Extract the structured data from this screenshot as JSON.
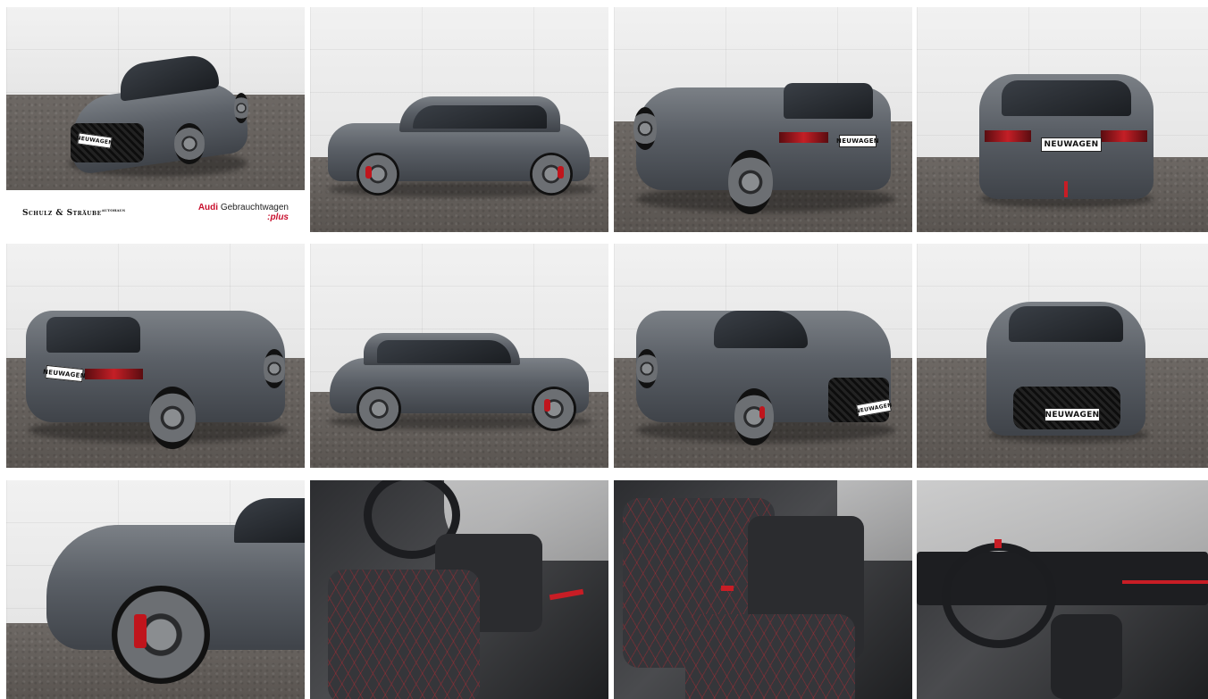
{
  "gallery": {
    "tiles": [
      {
        "id": "front-three-quarter-left",
        "plate": "NEUWAGEN"
      },
      {
        "id": "side-left",
        "plate": ""
      },
      {
        "id": "rear-three-quarter-left",
        "plate": "NEUWAGEN"
      },
      {
        "id": "rear",
        "plate": "NEUWAGEN"
      },
      {
        "id": "rear-three-quarter-right",
        "plate": "NEUWAGEN"
      },
      {
        "id": "side-right",
        "plate": ""
      },
      {
        "id": "front-three-quarter-right",
        "plate": "NEUWAGEN"
      },
      {
        "id": "front",
        "plate": "NEUWAGEN"
      },
      {
        "id": "front-wheel-detail",
        "plate": ""
      },
      {
        "id": "interior-front-seats",
        "plate": ""
      },
      {
        "id": "interior-rear-seats",
        "plate": ""
      },
      {
        "id": "interior-cockpit",
        "plate": ""
      }
    ]
  },
  "banner": {
    "dealer_name": "Schulz & Sträube",
    "dealer_suffix": "AUTOHAUS",
    "brand": "Audi",
    "program": "Gebrauchtwagen",
    "program_suffix": ":plus"
  },
  "colors": {
    "accent_red": "#c8102e",
    "car_grey": "#5a5f66"
  }
}
